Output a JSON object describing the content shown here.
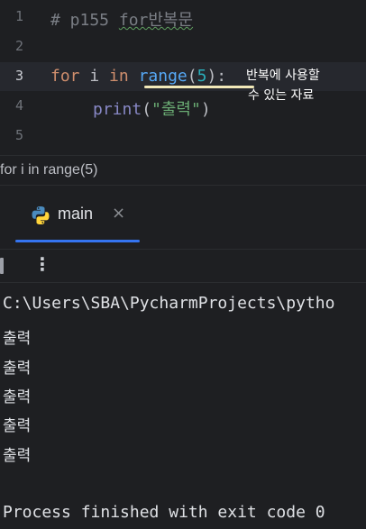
{
  "editor": {
    "line_numbers": [
      "1",
      "2",
      "3",
      "4",
      "5"
    ],
    "line1": {
      "comment_prefix": "# p155 ",
      "comment_underlined": "for반복문"
    },
    "line3": {
      "for": "for",
      "var": " i ",
      "in": "in",
      "space": " ",
      "range": "range",
      "open": "(",
      "num": "5",
      "close": "):"
    },
    "line4": {
      "print": "print",
      "open": "(",
      "str": "\"출력\"",
      "close": ")"
    },
    "annotation": {
      "line1": "반복에 사용할",
      "line2": "수 있는 자료"
    }
  },
  "breadcrumb": "for i in range(5)",
  "run_panel": {
    "tab_label": "main",
    "close_icon": "×",
    "more_label": "⋮",
    "output": [
      "C:\\Users\\SBA\\PycharmProjects\\pytho",
      "출력",
      "출력",
      "출력",
      "출력",
      "출력",
      "",
      "Process finished with exit code 0"
    ]
  },
  "colors": {
    "background": "#1e1f22",
    "keyword": "#cf8e6d",
    "function": "#56a8f5",
    "number": "#2aacb8",
    "string": "#6aab73",
    "tab_accent": "#3574f0"
  }
}
